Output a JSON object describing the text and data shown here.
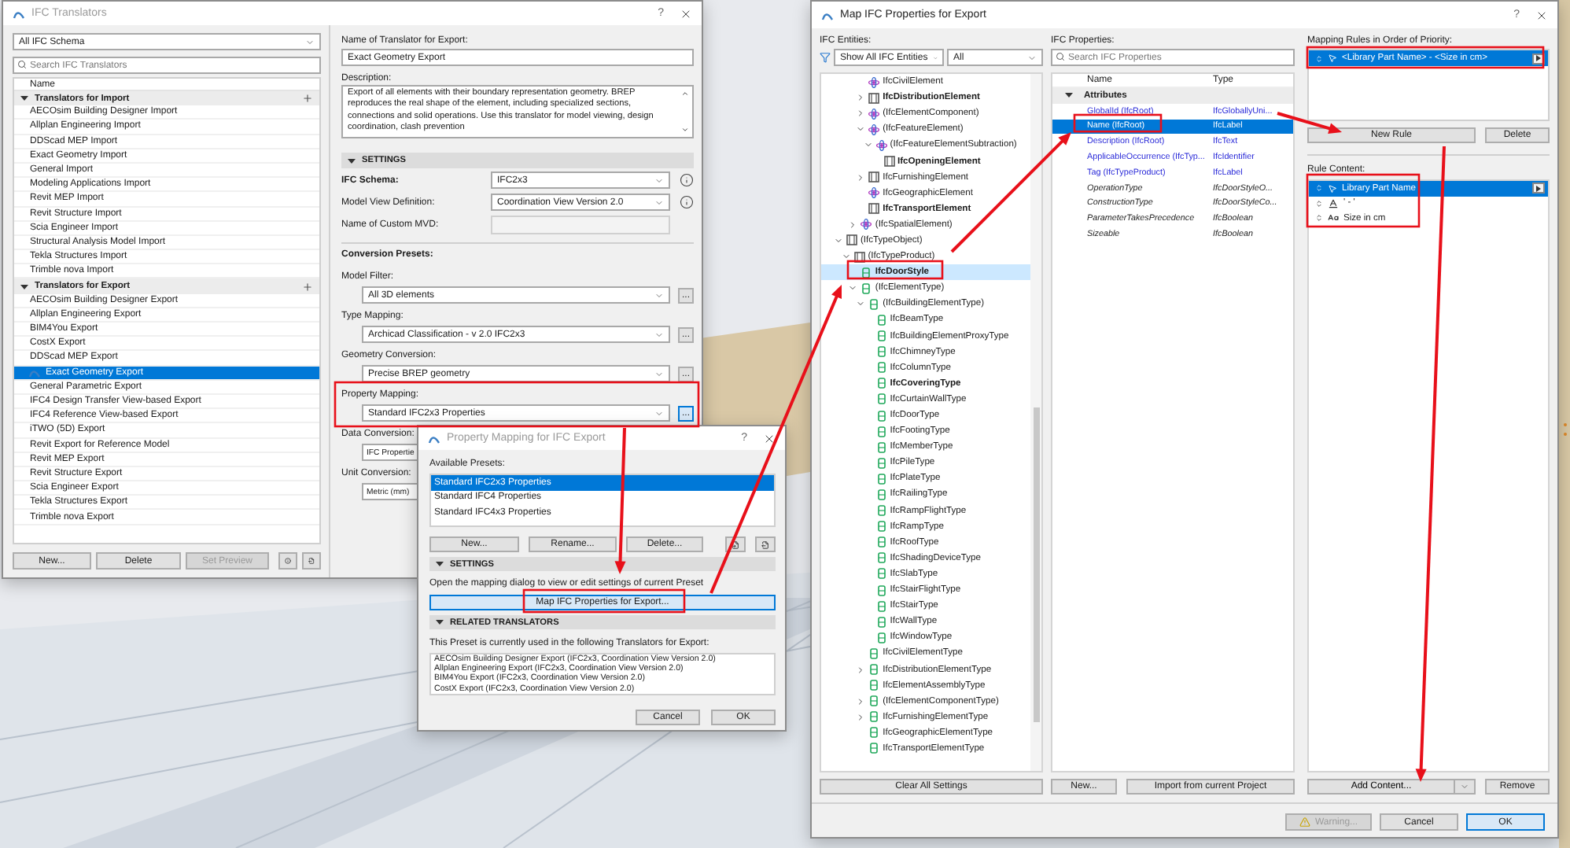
{
  "translators_window": {
    "title": "IFC Translators",
    "help": "?",
    "schema_filter": "All IFC Schema",
    "search": {
      "placeholder": "Search IFC Translators"
    },
    "list_header": "Name",
    "groups": [
      {
        "label": "Translators for Import",
        "expanded": true,
        "items": [
          {
            "label": "AECOsim Building Designer Import",
            "selected": false
          },
          {
            "label": "Allplan Engineering Import",
            "selected": false
          },
          {
            "label": "DDScad MEP Import",
            "selected": false
          },
          {
            "label": "Exact Geometry Import",
            "selected": false
          },
          {
            "label": "General Import",
            "selected": false
          },
          {
            "label": "Modeling Applications Import",
            "selected": false
          },
          {
            "label": "Revit MEP Import",
            "selected": false
          },
          {
            "label": "Revit Structure Import",
            "selected": false
          },
          {
            "label": "Scia Engineer Import",
            "selected": false
          },
          {
            "label": "Structural Analysis Model Import",
            "selected": false
          },
          {
            "label": "Tekla Structures Import",
            "selected": false
          },
          {
            "label": "Trimble nova Import",
            "selected": false
          }
        ]
      },
      {
        "label": "Translators for Export",
        "expanded": true,
        "items": [
          {
            "label": "AECOsim Building Designer Export",
            "selected": false
          },
          {
            "label": "Allplan Engineering Export",
            "selected": false
          },
          {
            "label": "BIM4You Export",
            "selected": false
          },
          {
            "label": "CostX Export",
            "selected": false
          },
          {
            "label": "DDScad MEP Export",
            "selected": false
          },
          {
            "label": "Exact Geometry Export",
            "selected": true
          },
          {
            "label": "General Parametric Export",
            "selected": false
          },
          {
            "label": "IFC4 Design Transfer View-based Export",
            "selected": false
          },
          {
            "label": "IFC4 Reference View-based Export",
            "selected": false
          },
          {
            "label": "iTWO (5D) Export",
            "selected": false
          },
          {
            "label": "Revit Export for Reference Model",
            "selected": false
          },
          {
            "label": "Revit MEP Export",
            "selected": false
          },
          {
            "label": "Revit Structure Export",
            "selected": false
          },
          {
            "label": "Scia Engineer Export",
            "selected": false
          },
          {
            "label": "Tekla Structures Export",
            "selected": false
          },
          {
            "label": "Trimble nova Export",
            "selected": false
          }
        ]
      }
    ],
    "buttons": [
      {
        "label": "New...",
        "disabled": false
      },
      {
        "label": "Delete",
        "disabled": false
      },
      {
        "label": "Set Preview",
        "disabled": true
      }
    ],
    "name_label": "Name of Translator for Export:",
    "name_value": "Exact Geometry Export",
    "description_label": "Description:",
    "description": "Export of all elements with their boundary representation geometry. BREP reproduces the real shape of the element, including specialized sections, connections and solid operations. Use this translator for model viewing, design coordination, clash prevention",
    "settings_header": "SETTINGS",
    "settings_expanded": true,
    "settings": [
      {
        "label": "IFC Schema:",
        "bold": true,
        "kind": "select",
        "value": "IFC2x3"
      },
      {
        "label": "Model View Definition:",
        "bold": false,
        "kind": "select",
        "value": "Coordination View Version 2.0"
      },
      {
        "label": "Name of Custom MVD:",
        "bold": false,
        "kind": "input",
        "disabled": true
      }
    ],
    "presets_title": "Conversion Presets:",
    "presets": [
      {
        "label": "Model Filter:",
        "value": "All 3D elements",
        "button": "...",
        "focused": false
      },
      {
        "label": "Type Mapping:",
        "value": "Archicad Classification - v 2.0 IFC2x3",
        "button": "...",
        "focused": false
      },
      {
        "label": "Geometry Conversion:",
        "value": "Precise BREP geometry",
        "button": "...",
        "focused": false
      },
      {
        "label": "Property Mapping:",
        "value": "Standard IFC2x3 Properties",
        "button": "...",
        "focused": true
      },
      {
        "label": "Data Conversion:",
        "value": "IFC Propertie"
      },
      {
        "label": "Unit Conversion:",
        "value": "Metric (mm)"
      }
    ]
  },
  "mapping_dialog": {
    "title": "Property Mapping for IFC Export",
    "help": "?",
    "presets_label": "Available Presets:",
    "presets": [
      {
        "label": "Standard IFC2x3 Properties",
        "selected": true
      },
      {
        "label": "Standard IFC4 Properties",
        "selected": false
      },
      {
        "label": "Standard IFC4x3 Properties",
        "selected": false
      }
    ],
    "buttons": [
      "New...",
      "Rename...",
      "Delete..."
    ],
    "settings_header": "SETTINGS",
    "settings_text": "Open the mapping dialog to view or edit settings of current Preset",
    "map_button": "Map IFC Properties for Export...",
    "related_header": "RELATED TRANSLATORS",
    "related_text": "This Preset is currently used in the following Translators for Export:",
    "related": [
      "AECOsim Building Designer Export (IFC2x3, Coordination View Version 2.0)",
      "Allplan Engineering Export (IFC2x3, Coordination View Version 2.0)",
      "BIM4You Export (IFC2x3, Coordination View Version 2.0)",
      "CostX Export (IFC2x3, Coordination View Version 2.0)"
    ],
    "footer": [
      "Cancel",
      "OK"
    ]
  },
  "properties_window": {
    "title": "Map IFC Properties for Export",
    "help": "?",
    "entities_label": "IFC Entities:",
    "entity_filter": "Show All IFC Entities",
    "entity_scope": "All",
    "tree": [
      {
        "children": [
          {
            "children": [
              {
                "children": [
                  {
                    "label": "IfcCivilElement",
                    "kind": "element",
                    "bold": false,
                    "selected": false
                  },
                  {
                    "label": "IfcDistributionElement",
                    "kind": "object",
                    "bold": true,
                    "selected": false,
                    "expanded": false
                  },
                  {
                    "label": "(IfcElementComponent)",
                    "kind": "element",
                    "bold": false,
                    "selected": false,
                    "expanded": false
                  },
                  {
                    "label": "(IfcFeatureElement)",
                    "kind": "element",
                    "bold": false,
                    "selected": false,
                    "expanded": true,
                    "children": [
                      {
                        "label": "(IfcFeatureElementSubtraction)",
                        "kind": "element",
                        "bold": false,
                        "selected": false,
                        "expanded": true,
                        "children": [
                          {
                            "label": "IfcOpeningElement",
                            "kind": "object",
                            "bold": true,
                            "selected": false
                          }
                        ]
                      }
                    ]
                  },
                  {
                    "label": "IfcFurnishingElement",
                    "kind": "object",
                    "bold": false,
                    "selected": false,
                    "expanded": false
                  },
                  {
                    "label": "IfcGeographicElement",
                    "kind": "element",
                    "bold": false,
                    "selected": false
                  },
                  {
                    "label": "IfcTransportElement",
                    "kind": "object",
                    "bold": true,
                    "selected": false
                  }
                ]
              },
              {
                "label": "(IfcSpatialElement)",
                "kind": "element",
                "bold": false,
                "selected": false,
                "expanded": false
              }
            ]
          }
        ]
      },
      {
        "label": "(IfcTypeObject)",
        "kind": "object",
        "bold": false,
        "selected": false,
        "expanded": true,
        "children": [
          {
            "label": "(IfcTypeProduct)",
            "kind": "object",
            "bold": false,
            "selected": false,
            "expanded": true,
            "children": [
              {
                "label": "IfcDoorStyle",
                "kind": "type",
                "bold": true,
                "selected": true
              },
              {
                "label": "(IfcElementType)",
                "kind": "type",
                "bold": false,
                "selected": false,
                "expanded": true,
                "children": [
                  {
                    "label": "(IfcBuildingElementType)",
                    "kind": "type",
                    "bold": false,
                    "selected": false,
                    "expanded": true,
                    "children": [
                      {
                        "label": "IfcBeamType",
                        "kind": "type",
                        "bold": false,
                        "selected": false
                      },
                      {
                        "label": "IfcBuildingElementProxyType",
                        "kind": "type",
                        "bold": false,
                        "selected": false
                      },
                      {
                        "label": "IfcChimneyType",
                        "kind": "type",
                        "bold": false,
                        "selected": false
                      },
                      {
                        "label": "IfcColumnType",
                        "kind": "type",
                        "bold": false,
                        "selected": false
                      },
                      {
                        "label": "IfcCoveringType",
                        "kind": "type",
                        "bold": true,
                        "selected": false
                      },
                      {
                        "label": "IfcCurtainWallType",
                        "kind": "type",
                        "bold": false,
                        "selected": false
                      },
                      {
                        "label": "IfcDoorType",
                        "kind": "type",
                        "bold": false,
                        "selected": false
                      },
                      {
                        "label": "IfcFootingType",
                        "kind": "type",
                        "bold": false,
                        "selected": false
                      },
                      {
                        "label": "IfcMemberType",
                        "kind": "type",
                        "bold": false,
                        "selected": false
                      },
                      {
                        "label": "IfcPileType",
                        "kind": "type",
                        "bold": false,
                        "selected": false
                      },
                      {
                        "label": "IfcPlateType",
                        "kind": "type",
                        "bold": false,
                        "selected": false
                      },
                      {
                        "label": "IfcRailingType",
                        "kind": "type",
                        "bold": false,
                        "selected": false
                      },
                      {
                        "label": "IfcRampFlightType",
                        "kind": "type",
                        "bold": false,
                        "selected": false
                      },
                      {
                        "label": "IfcRampType",
                        "kind": "type",
                        "bold": false,
                        "selected": false
                      },
                      {
                        "label": "IfcRoofType",
                        "kind": "type",
                        "bold": false,
                        "selected": false
                      },
                      {
                        "label": "IfcShadingDeviceType",
                        "kind": "type",
                        "bold": false,
                        "selected": false
                      },
                      {
                        "label": "IfcSlabType",
                        "kind": "type",
                        "bold": false,
                        "selected": false
                      },
                      {
                        "label": "IfcStairFlightType",
                        "kind": "type",
                        "bold": false,
                        "selected": false
                      },
                      {
                        "label": "IfcStairType",
                        "kind": "type",
                        "bold": false,
                        "selected": false
                      },
                      {
                        "label": "IfcWallType",
                        "kind": "type",
                        "bold": false,
                        "selected": false
                      },
                      {
                        "label": "IfcWindowType",
                        "kind": "type",
                        "bold": false,
                        "selected": false
                      }
                    ]
                  },
                  {
                    "label": "IfcCivilElementType",
                    "kind": "type",
                    "bold": false,
                    "selected": false
                  },
                  {
                    "label": "IfcDistributionElementType",
                    "kind": "type",
                    "bold": false,
                    "selected": false,
                    "expanded": false
                  },
                  {
                    "label": "IfcElementAssemblyType",
                    "kind": "type",
                    "bold": false,
                    "selected": false
                  },
                  {
                    "label": "(IfcElementComponentType)",
                    "kind": "type",
                    "bold": false,
                    "selected": false,
                    "expanded": false
                  },
                  {
                    "label": "IfcFurnishingElementType",
                    "kind": "type",
                    "bold": false,
                    "selected": false,
                    "expanded": false
                  },
                  {
                    "label": "IfcGeographicElementType",
                    "kind": "type",
                    "bold": false,
                    "selected": false
                  },
                  {
                    "label": "IfcTransportElementType",
                    "kind": "type",
                    "bold": false,
                    "selected": false
                  }
                ]
              }
            ]
          }
        ]
      }
    ],
    "clear_button": "Clear All Settings",
    "properties_label": "IFC Properties:",
    "properties_search": {
      "placeholder": "Search IFC Properties"
    },
    "columns": [
      "Name",
      "Type"
    ],
    "property_groups": [
      {
        "label": "Attributes",
        "expanded": true,
        "rows": [
          {
            "name": "GlobalId (IfcRoot)",
            "type": "IfcGloballyUni...",
            "defined": true,
            "selected": false
          },
          {
            "name": "Name (IfcRoot)",
            "type": "IfcLabel",
            "defined": true,
            "selected": true
          },
          {
            "name": "Description (IfcRoot)",
            "type": "IfcText",
            "defined": true,
            "selected": false
          },
          {
            "name": "ApplicableOccurrence (IfcTyp...",
            "type": "IfcIdentifier",
            "defined": true,
            "selected": false
          },
          {
            "name": "Tag (IfcTypeProduct)",
            "type": "IfcLabel",
            "defined": true,
            "selected": false
          },
          {
            "name": "OperationType",
            "type": "IfcDoorStyleO...",
            "defined": false,
            "selected": false
          },
          {
            "name": "ConstructionType",
            "type": "IfcDoorStyleCo...",
            "defined": false,
            "selected": false
          },
          {
            "name": "ParameterTakesPrecedence",
            "type": "IfcBoolean",
            "defined": false,
            "selected": false
          },
          {
            "name": "Sizeable",
            "type": "IfcBoolean",
            "defined": false,
            "selected": false
          }
        ]
      }
    ],
    "property_buttons": [
      "New...",
      "Import from current Project"
    ],
    "rules_label": "Mapping Rules in Order of Priority:",
    "rules": [
      {
        "label": "<Library Part Name> - <Size in cm>",
        "selected": true
      }
    ],
    "rule_buttons": [
      "New Rule",
      "Delete"
    ],
    "content_label": "Rule Content:",
    "content": [
      {
        "kind": "property",
        "label": "Library Part Name",
        "selected": true
      },
      {
        "kind": "string",
        "label": "' - '",
        "selected": false
      },
      {
        "kind": "text",
        "label": "Size in cm",
        "selected": false
      }
    ],
    "add_button": "Add Content...",
    "remove_button": "Remove",
    "footer": [
      {
        "kind": "warning",
        "label": "Warning...",
        "disabled": true
      },
      {
        "kind": "cancel",
        "label": "Cancel",
        "disabled": false
      },
      {
        "kind": "confirm",
        "label": "OK",
        "disabled": false
      }
    ]
  }
}
